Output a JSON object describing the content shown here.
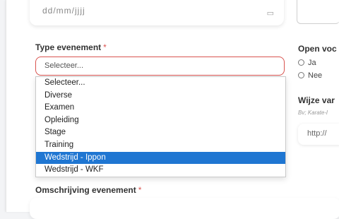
{
  "top_date_field": {
    "value": "dd/mm/jjjj",
    "icon": "calendar-icon"
  },
  "type_event": {
    "label": "Type evenement",
    "required_mark": "*",
    "placeholder": "Selecteer...",
    "options": [
      "Selecteer...",
      "Diverse",
      "Examen",
      "Opleiding",
      "Stage",
      "Training",
      "Wedstrijd - Ippon",
      "Wedstrijd - WKF"
    ],
    "highlighted_option": "Wedstrijd - Ippon"
  },
  "open_section": {
    "label": "Open voc",
    "options": [
      "Ja",
      "Nee"
    ]
  },
  "wijze_section": {
    "label": "Wijze var",
    "hint": "Bv; Karate-l",
    "url_value": "http://"
  },
  "description": {
    "label": "Omschrijving evenement",
    "required_mark": "*"
  },
  "colors": {
    "accent": "#1f76d2",
    "error": "#d9534f"
  }
}
